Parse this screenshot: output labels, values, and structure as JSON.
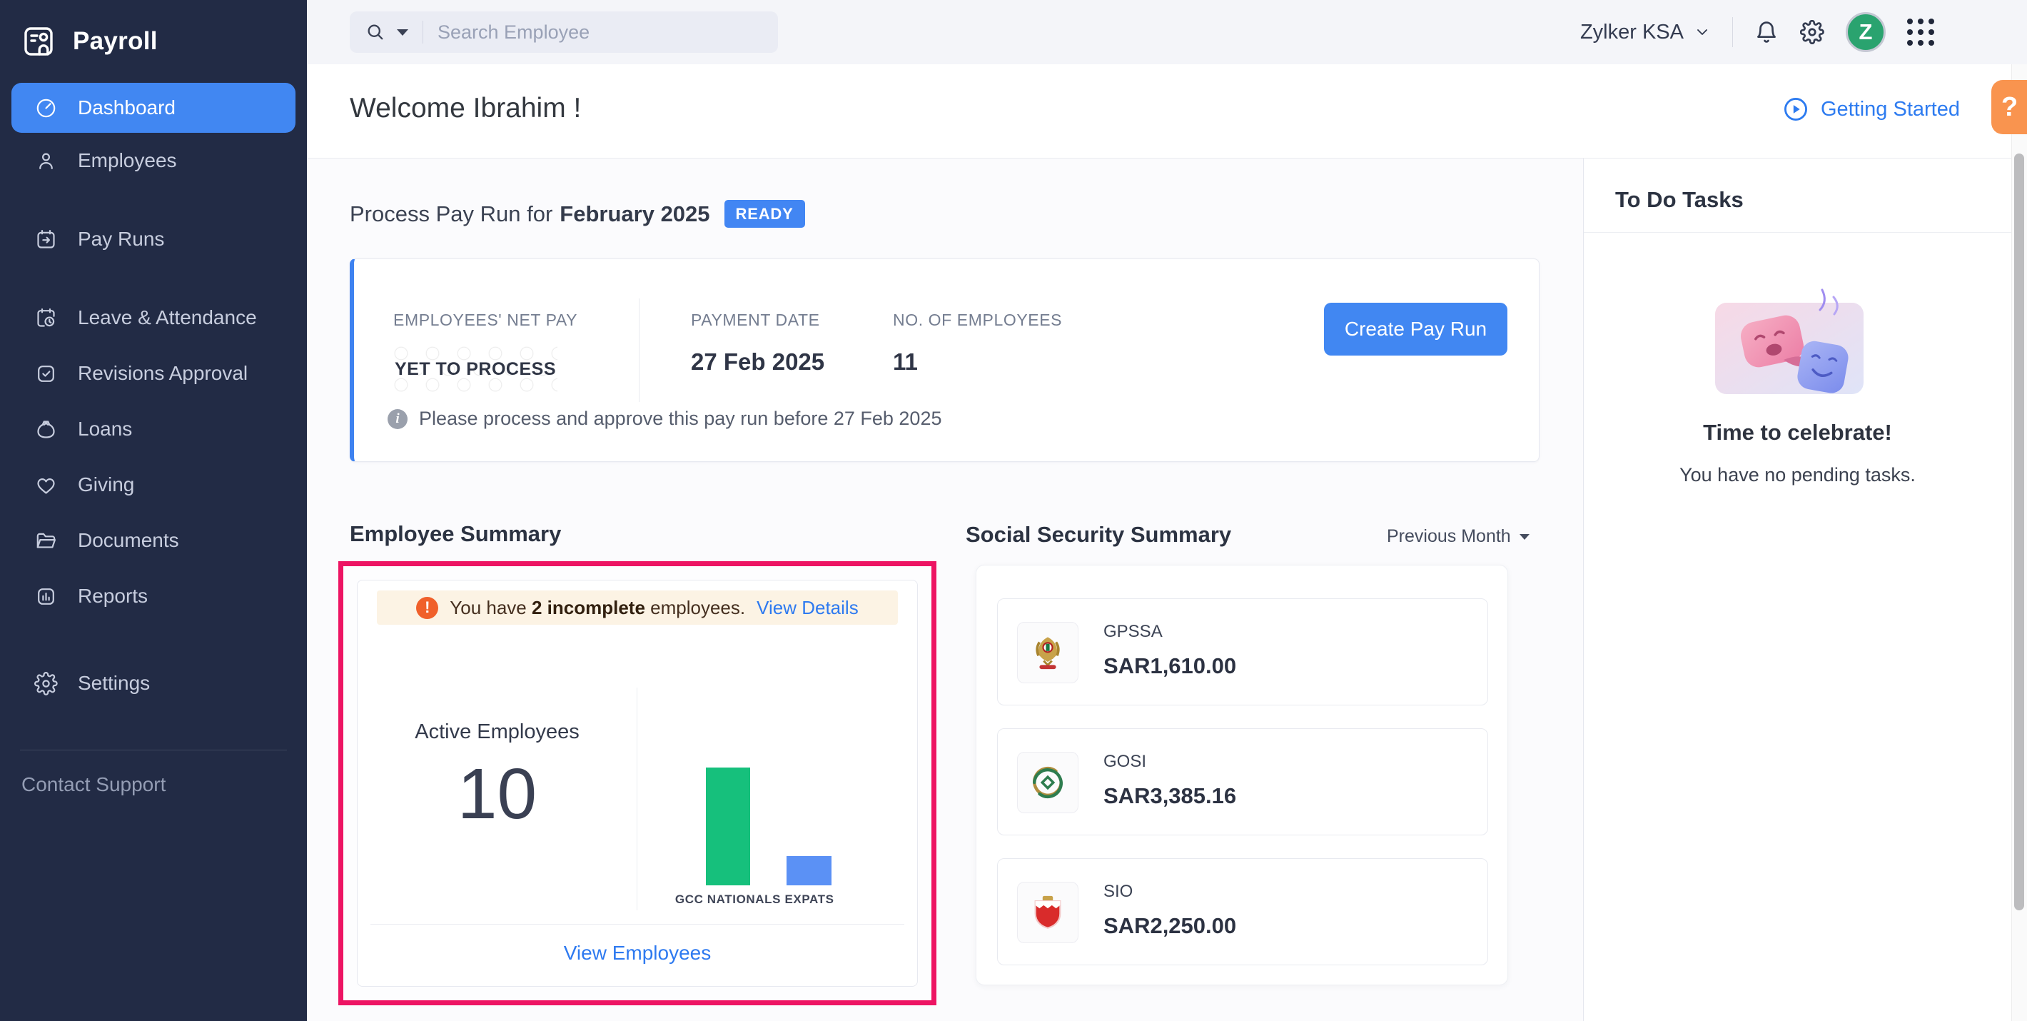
{
  "app": {
    "name": "Payroll"
  },
  "topbar": {
    "search_placeholder": "Search Employee",
    "org_name": "Zylker KSA",
    "avatar_letter": "Z"
  },
  "sidebar": {
    "items": [
      {
        "label": "Dashboard",
        "active": true
      },
      {
        "label": "Employees",
        "active": false
      },
      {
        "label": "Pay Runs",
        "active": false
      },
      {
        "label": "Leave & Attendance",
        "active": false
      },
      {
        "label": "Revisions Approval",
        "active": false
      },
      {
        "label": "Loans",
        "active": false
      },
      {
        "label": "Giving",
        "active": false
      },
      {
        "label": "Documents",
        "active": false
      },
      {
        "label": "Reports",
        "active": false
      },
      {
        "label": "Settings",
        "active": false
      }
    ],
    "footer_link": "Contact Support"
  },
  "header": {
    "welcome": "Welcome Ibrahim !",
    "getting_started": "Getting Started",
    "help_label": "?"
  },
  "payrun": {
    "title_prefix": "Process Pay Run for",
    "period": "February 2025",
    "status": "READY",
    "fields": [
      {
        "label": "EMPLOYEES' NET PAY",
        "value": "YET TO PROCESS"
      },
      {
        "label": "PAYMENT DATE",
        "value": "27 Feb 2025"
      },
      {
        "label": "NO. OF EMPLOYEES",
        "value": "11"
      }
    ],
    "cta": "Create Pay Run",
    "note": "Please process and approve this pay run before 27 Feb 2025"
  },
  "employee_summary": {
    "title": "Employee Summary",
    "warning": {
      "pre": "You have ",
      "bold": "2 incomplete",
      "post": " employees. ",
      "link": "View Details"
    },
    "active_label": "Active Employees",
    "active_count": "10",
    "view_link": "View Employees",
    "chart_data": {
      "type": "bar",
      "categories": [
        "GCC NATIONALS",
        "EXPATS"
      ],
      "values": [
        8,
        2
      ],
      "colors": [
        "#16c07c",
        "#5b91f5"
      ],
      "title": "Active Employees split",
      "xlabel": "",
      "ylabel": "",
      "ylim": [
        0,
        8
      ],
      "grid": false,
      "legend": "none"
    }
  },
  "social_security": {
    "title": "Social Security Summary",
    "filter": "Previous Month",
    "items": [
      {
        "name": "GPSSA",
        "amount": "SAR1,610.00"
      },
      {
        "name": "GOSI",
        "amount": "SAR3,385.16"
      },
      {
        "name": "SIO",
        "amount": "SAR2,250.00"
      }
    ]
  },
  "todo": {
    "title": "To Do Tasks",
    "headline": "Time to celebrate!",
    "subtext": "You have no pending tasks."
  }
}
